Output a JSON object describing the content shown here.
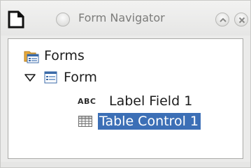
{
  "window": {
    "title": "Form Navigator"
  },
  "titlebar": {
    "app_icon": "document-icon",
    "menu_button_icon": "circle-menu-icon",
    "shade_button_icon": "chevron-up-icon",
    "close_button_icon": "close-icon"
  },
  "tree": {
    "root": {
      "label": "Forms",
      "icon": "forms-folder-icon"
    },
    "form": {
      "label": "Form",
      "icon": "form-icon",
      "expanded": true
    },
    "children": [
      {
        "label": "Label Field 1",
        "icon": "label-field-icon",
        "icon_text": "ABC",
        "selected": false
      },
      {
        "label": "Table Control 1",
        "icon": "table-control-icon",
        "selected": true
      }
    ]
  },
  "colors": {
    "selection": "#3c6fb6",
    "title_text": "#7c7c7a",
    "panel_bg": "#ffffff"
  }
}
